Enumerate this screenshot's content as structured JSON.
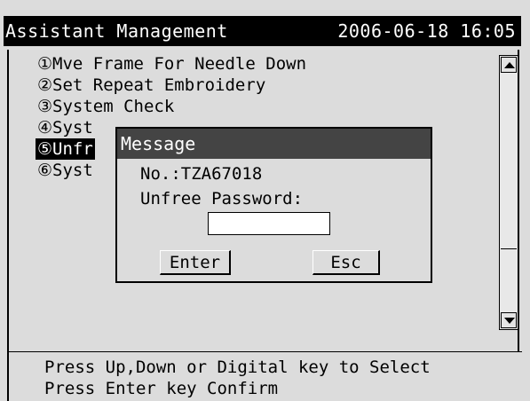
{
  "title_bar": {
    "title": "Assistant Management",
    "datetime": "2006-06-18 16:05"
  },
  "menu": {
    "items": [
      {
        "label": "①Mve Frame For Needle Down",
        "selected": false
      },
      {
        "label": "②Set Repeat Embroidery",
        "selected": false
      },
      {
        "label": "③System Check",
        "selected": false
      },
      {
        "label": "④Syst",
        "selected": false
      },
      {
        "label": "⑤Unfr",
        "selected": true
      },
      {
        "label": "⑥Syst",
        "selected": false
      }
    ]
  },
  "scrollbar": {
    "up_icon": "arrow-up-icon",
    "down_icon": "arrow-down-icon"
  },
  "dialog": {
    "title": "Message",
    "number_line": "No.:TZA67018",
    "password_label": "Unfree Password:",
    "password_value": "",
    "enter_label": "Enter",
    "esc_label": "Esc"
  },
  "hints": {
    "line1": "Press Up,Down or Digital key to  Select",
    "line2": "Press Enter key Confirm"
  },
  "colors": {
    "background": "#dcdcdc",
    "title_bar": "#000000",
    "dialog_title": "#444444",
    "selected_item": "#000000"
  }
}
